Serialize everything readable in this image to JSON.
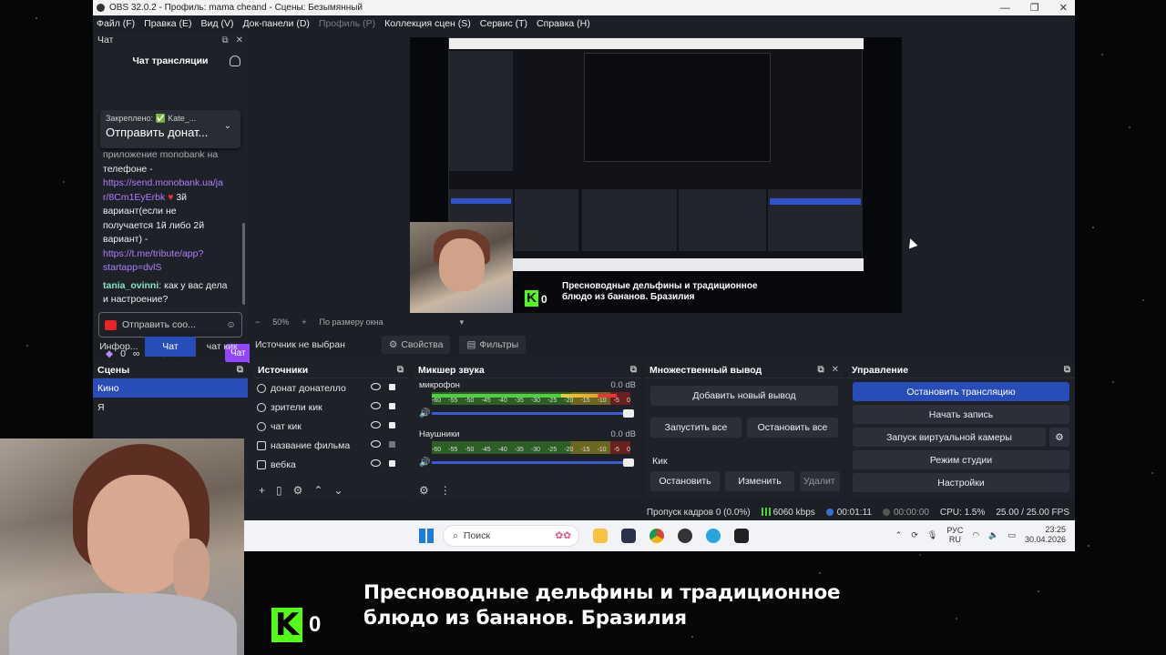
{
  "window": {
    "title": "OBS 32.0.2 - Профиль: mama cheand - Сцены: Безымянный",
    "controls": [
      "—",
      "❐",
      "✕"
    ]
  },
  "menu": [
    "Файл (F)",
    "Правка (E)",
    "Вид (V)",
    "Док-панели (D)",
    "Профиль (P)",
    "Коллекция сцен (S)",
    "Сервис (T)",
    "Справка (H)"
  ],
  "chat": {
    "dock_title": "Чат",
    "header": "Чат трансляции",
    "pinned_small": "Закреплено: ✅ Kate_...",
    "pinned_big": "Отправить донат...",
    "msg_line1": "приложение monobank на",
    "msg_line2": "телефоне -",
    "link1a": "https://send.monobank.ua/ja",
    "link1b": "r/8Cm1EyErbk",
    "msg_line3": "3й",
    "msg_line4": "вариант(если не",
    "msg_line5": "получается 1й либо 2й",
    "msg_line6": "вариант) -",
    "link2a": "https://t.me/tribute/app?",
    "link2b": "startapp=dvlS",
    "user": "tania_ovinni",
    "msg_user": ": как у вас дела и настроение?",
    "input_placeholder": "Отправить соо...",
    "points": "0",
    "button": "Чат"
  },
  "dock_tabs": [
    "Инфор...",
    "Чат",
    "чат кик"
  ],
  "preview": {
    "zoom": "50%",
    "fit": "По размеру окна",
    "kick_count": "0",
    "caption_line1": "Пресноводные дельфины и традиционное",
    "caption_line2": "блюдо из бананов. Бразилия"
  },
  "source_bar": {
    "label": "Источник не выбран",
    "properties": "Свойства",
    "filters": "Фильтры"
  },
  "scenes": {
    "title": "Сцены",
    "items": [
      "Кино",
      "Я"
    ]
  },
  "sources": {
    "title": "Источники",
    "items": [
      "донат донателло",
      "зрители кик",
      "чат кик",
      "название фильма",
      "вебка"
    ]
  },
  "mixer": {
    "title": "Микшер звука",
    "channels": [
      {
        "name": "микрофон",
        "db": "0.0 dB",
        "level": 0.93
      },
      {
        "name": "Наушники",
        "db": "0.0 dB",
        "level": 0.0
      }
    ],
    "scale": [
      "-60",
      "-55",
      "-50",
      "-45",
      "-40",
      "-35",
      "-30",
      "-25",
      "-20",
      "-15",
      "-10",
      "-5",
      "0"
    ]
  },
  "multi_output": {
    "title": "Множественный вывод",
    "add": "Добавить новый вывод",
    "start_all": "Запустить все",
    "stop_all": "Остановить все",
    "kick_label": "Кик",
    "stop": "Остановить",
    "edit": "Изменить",
    "delete": "Удалит"
  },
  "controls": {
    "title": "Управление",
    "stop_stream": "Остановить трансляцию",
    "start_record": "Начать запись",
    "virtual_cam": "Запуск виртуальной камеры",
    "studio": "Режим студии",
    "settings": "Настройки"
  },
  "status": {
    "dropped": "Пропуск кадров 0 (0.0%)",
    "bitrate": "6060 kbps",
    "stream_time": "00:01:11",
    "rec_time": "00:00:00",
    "cpu": "CPU: 1.5%",
    "fps": "25.00 / 25.00 FPS"
  },
  "taskbar": {
    "search": "Поиск",
    "lang1": "РУС",
    "lang2": "RU",
    "time": "23:25",
    "date": "30.04.2026"
  },
  "overlay": {
    "kick_count": "0",
    "caption_line1": "Пресноводные дельфины и традиционное",
    "caption_line2": "блюдо из бананов. Бразилия"
  }
}
